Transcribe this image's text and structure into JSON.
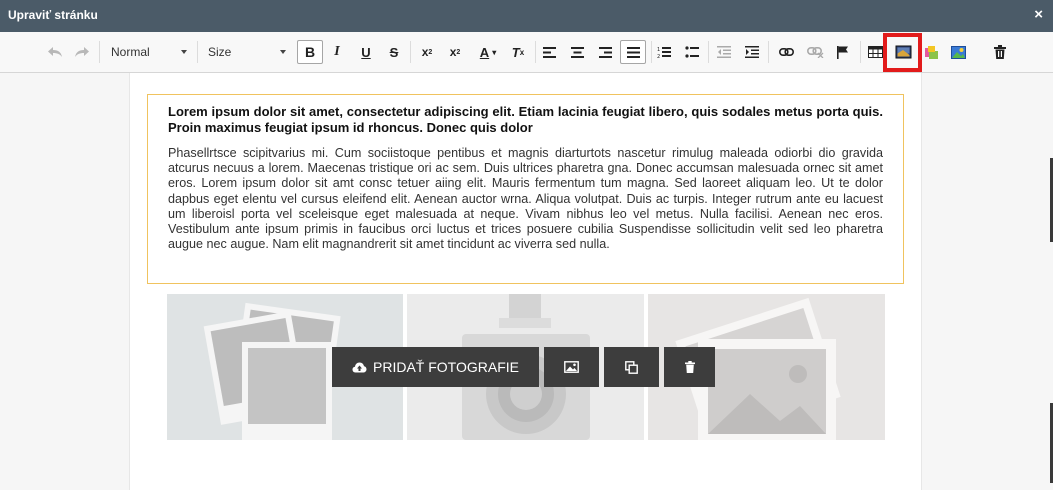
{
  "dialog": {
    "title": "Upraviť stránku",
    "close_symbol": "×"
  },
  "toolbar": {
    "format_select": "Normal",
    "size_select": "Size",
    "icons": [
      "undo-icon",
      "redo-icon",
      "bold-icon",
      "italic-icon",
      "underline-icon",
      "strikethrough-icon",
      "subscript-icon",
      "superscript-icon",
      "text-color-icon",
      "clear-format-icon",
      "align-left-icon",
      "align-center-icon",
      "align-right-icon",
      "align-justify-icon",
      "ordered-list-icon",
      "unordered-list-icon",
      "outdent-icon",
      "indent-icon",
      "link-icon",
      "unlink-icon",
      "flag-icon",
      "table-icon",
      "image-gallery-icon",
      "widget-icon",
      "image-icon",
      "delete-icon"
    ],
    "highlight_color": "#e21b1b"
  },
  "content": {
    "heading": "Lorem ipsum dolor sit amet, consectetur adipiscing elit. Etiam lacinia feugiat libero, quis sodales metus porta quis. Proin maximus feugiat ipsum id rhoncus. Donec quis dolor",
    "paragraph": "Phasellrtsce scipitvarius mi. Cum sociistoque pentibus et magnis diarturtots nascetur rimulug maleada odiorbi dio gravida atcurus necuus a lorem. Maecenas tristique ori ac sem. Duis ultrices pharetra gna. Donec accumsan malesuada ornec sit amet eros. Lorem ipsum dolor sit amt consc tetuer aiing elit. Mauris fermentum tum magna. Sed laoreet aliquam leo. Ut te dolor dapbus eget elentu vel cursus eleifend elit. Aenean auctor wrna. Aliqua volutpat. Duis ac turpis. Integer rutrum ante eu lacuest um liberoisl porta vel sceleisque eget malesuada at neque. Vivam nibhus leo vel metus. Nulla facilisi. Aenean nec eros. Vestibulum ante ipsum primis in faucibus orci luctus et trices posuere cubilia Suspendisse sollicitudin velit sed leo pharetra augue nec augue. Nam elit magnandrerit sit amet tincidunt ac viverra sed nulla.",
    "text_border_color": "#f0c35e"
  },
  "gallery": {
    "add_photos_label": "PRIDAŤ FOTOGRAFIE",
    "placeholders": [
      "photos-placeholder-icon",
      "camera-placeholder-icon",
      "picture-placeholder-icon"
    ]
  }
}
